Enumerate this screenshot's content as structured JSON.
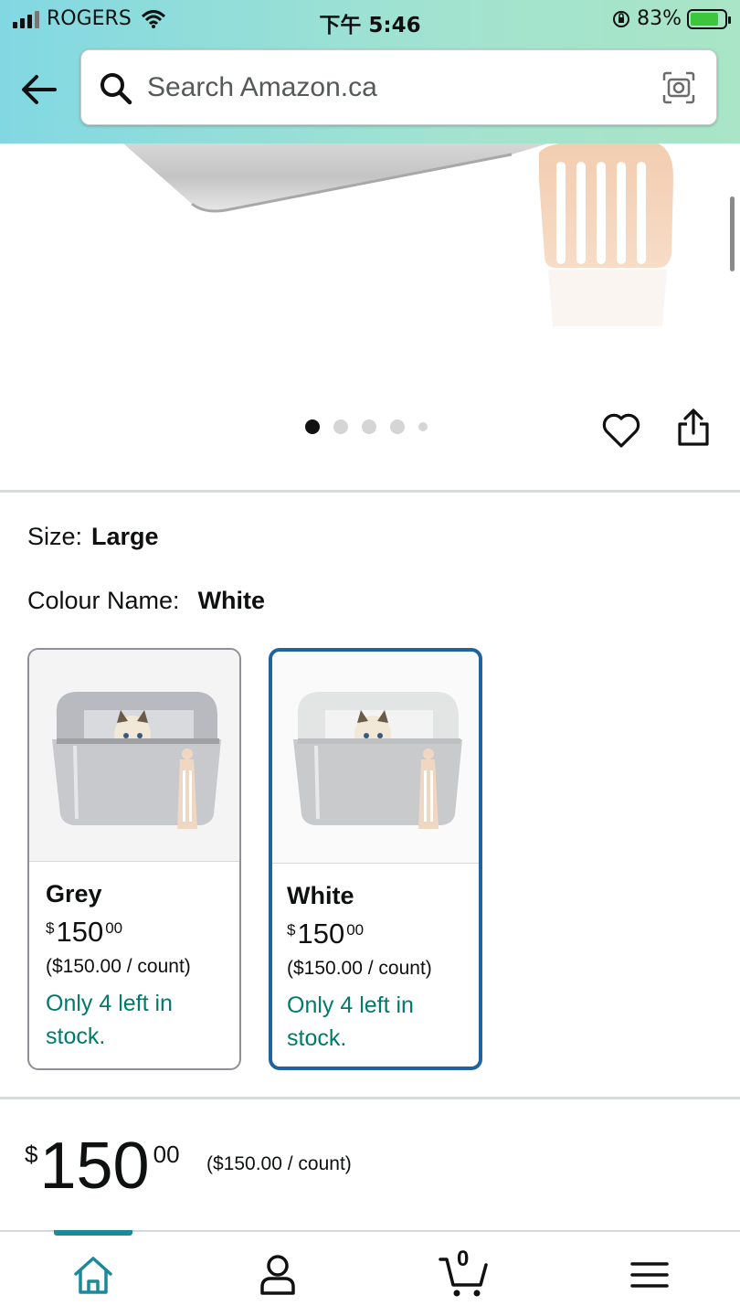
{
  "status_bar": {
    "carrier": "ROGERS",
    "time": "下午 5:46",
    "battery_percent": "83%"
  },
  "search": {
    "placeholder": "Search Amazon.ca"
  },
  "gallery": {
    "image_count": 5,
    "active_index": 0
  },
  "variations": {
    "size_label": "Size:",
    "size_value": "Large",
    "colour_label": "Colour Name:",
    "colour_value": "White"
  },
  "swatches": [
    {
      "name": "Grey",
      "price_symbol": "$",
      "price_whole": "150",
      "price_cents": "00",
      "unit_price": "($150.00 / count)",
      "stock": "Only 4 left in stock.",
      "selected": false
    },
    {
      "name": "White",
      "price_symbol": "$",
      "price_whole": "150",
      "price_cents": "00",
      "unit_price": "($150.00 / count)",
      "stock": "Only 4 left in stock.",
      "selected": true
    }
  ],
  "price": {
    "symbol": "$",
    "whole": "150",
    "cents": "00",
    "unit_price": "($150.00 / count)"
  },
  "bottom_nav": {
    "items": [
      "home-icon",
      "account-icon",
      "cart-icon",
      "menu-icon"
    ],
    "cart_count": "0",
    "active": "home"
  },
  "colors": {
    "accent_teal": "#1a8a9a",
    "selected_border": "#2162a1",
    "stock_green": "#007a6b"
  }
}
